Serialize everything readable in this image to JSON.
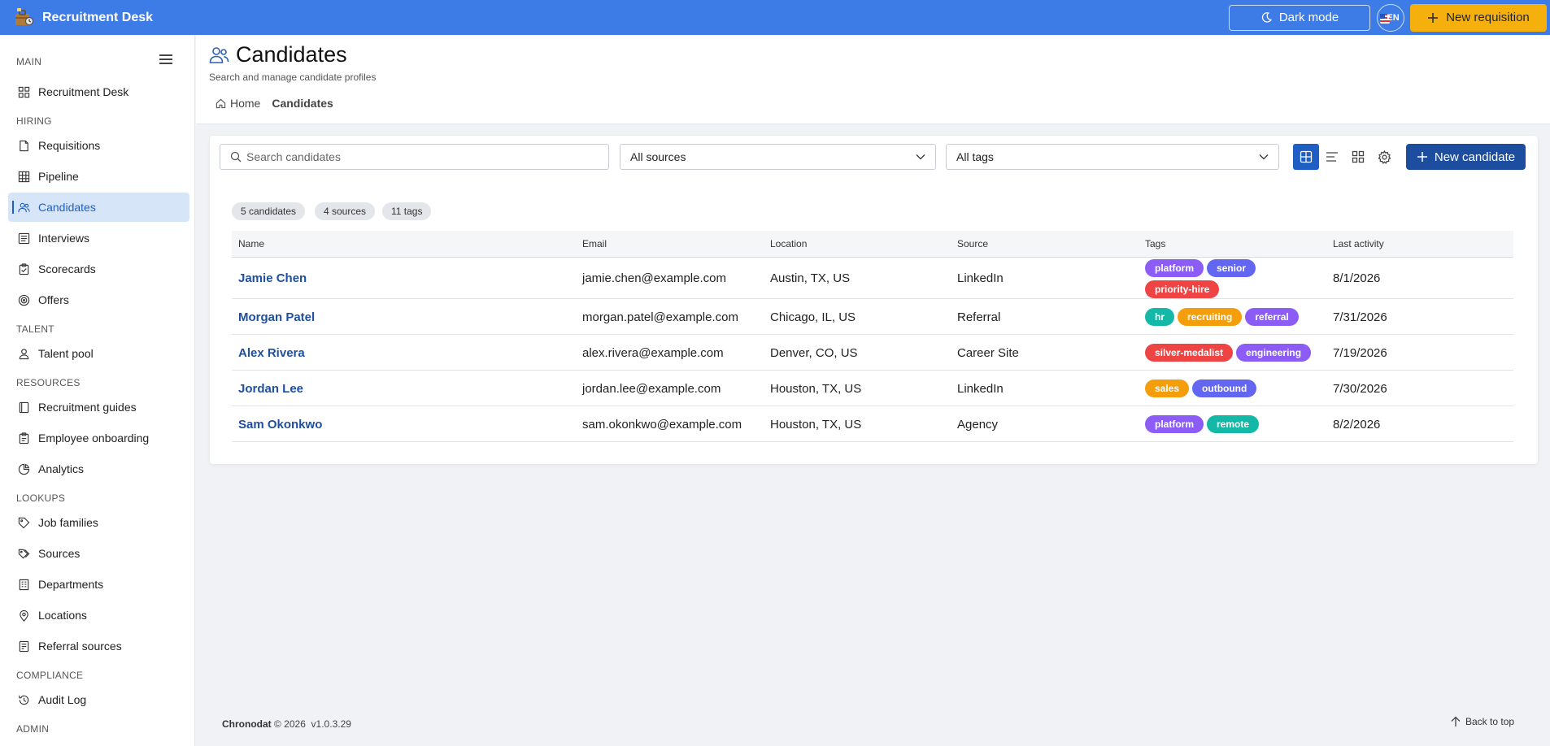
{
  "app": {
    "title": "Recruitment Desk",
    "dark_mode_label": "Dark mode",
    "language": "EN",
    "new_requisition_label": "New requisition"
  },
  "sidebar": {
    "groups": [
      {
        "heading": "MAIN",
        "items": [
          {
            "label": "Recruitment Desk",
            "icon": "dashboard-icon"
          }
        ]
      },
      {
        "heading": "HIRING",
        "items": [
          {
            "label": "Requisitions",
            "icon": "document-icon"
          },
          {
            "label": "Pipeline",
            "icon": "grid-table-icon"
          },
          {
            "label": "Candidates",
            "icon": "people-icon",
            "active": true
          },
          {
            "label": "Interviews",
            "icon": "list-icon"
          },
          {
            "label": "Scorecards",
            "icon": "clipboard-check-icon"
          },
          {
            "label": "Offers",
            "icon": "target-icon"
          }
        ]
      },
      {
        "heading": "TALENT",
        "items": [
          {
            "label": "Talent pool",
            "icon": "person-icon"
          }
        ]
      },
      {
        "heading": "RESOURCES",
        "items": [
          {
            "label": "Recruitment guides",
            "icon": "book-icon"
          },
          {
            "label": "Employee onboarding",
            "icon": "clipboard-icon"
          },
          {
            "label": "Analytics",
            "icon": "chart-icon"
          }
        ]
      },
      {
        "heading": "LOOKUPS",
        "items": [
          {
            "label": "Job families",
            "icon": "tag-icon"
          },
          {
            "label": "Sources",
            "icon": "tags-icon"
          },
          {
            "label": "Departments",
            "icon": "building-icon"
          },
          {
            "label": "Locations",
            "icon": "pin-icon"
          },
          {
            "label": "Referral sources",
            "icon": "form-icon"
          }
        ]
      },
      {
        "heading": "COMPLIANCE",
        "items": [
          {
            "label": "Audit Log",
            "icon": "history-icon"
          }
        ]
      },
      {
        "heading": "ADMIN",
        "items": []
      }
    ]
  },
  "header": {
    "title": "Candidates",
    "subtitle": "Search and manage candidate profiles",
    "breadcrumb_home": "Home",
    "breadcrumb_current": "Candidates"
  },
  "toolbar": {
    "search_placeholder": "Search candidates",
    "source_filter": "All sources",
    "tag_filter": "All tags",
    "new_candidate_label": "New candidate"
  },
  "summary": {
    "candidates": "5 candidates",
    "sources": "4 sources",
    "tags": "11 tags"
  },
  "table": {
    "columns": [
      "Name",
      "Email",
      "Location",
      "Source",
      "Tags",
      "Last activity"
    ],
    "rows": [
      {
        "name": "Jamie Chen",
        "email": "jamie.chen@example.com",
        "location": "Austin, TX, US",
        "source": "LinkedIn",
        "tags": [
          "platform",
          "senior",
          "priority-hire"
        ],
        "last_activity": "8/1/2026"
      },
      {
        "name": "Morgan Patel",
        "email": "morgan.patel@example.com",
        "location": "Chicago, IL, US",
        "source": "Referral",
        "tags": [
          "hr",
          "recruiting",
          "referral"
        ],
        "last_activity": "7/31/2026"
      },
      {
        "name": "Alex Rivera",
        "email": "alex.rivera@example.com",
        "location": "Denver, CO, US",
        "source": "Career Site",
        "tags": [
          "silver-medalist",
          "engineering"
        ],
        "last_activity": "7/19/2026"
      },
      {
        "name": "Jordan Lee",
        "email": "jordan.lee@example.com",
        "location": "Houston, TX, US",
        "source": "LinkedIn",
        "tags": [
          "sales",
          "outbound"
        ],
        "last_activity": "7/30/2026"
      },
      {
        "name": "Sam Okonkwo",
        "email": "sam.okonkwo@example.com",
        "location": "Houston, TX, US",
        "source": "Agency",
        "tags": [
          "platform",
          "remote"
        ],
        "last_activity": "8/2/2026"
      }
    ]
  },
  "tag_colors": {
    "platform": "#8b5cf6",
    "senior": "#6366f1",
    "priority-hire": "#ef4444",
    "hr": "#14b8a6",
    "recruiting": "#f59e0b",
    "referral": "#8b5cf6",
    "silver-medalist": "#ef4444",
    "engineering": "#8b5cf6",
    "sales": "#f59e0b",
    "outbound": "#6366f1",
    "remote": "#14b8a6"
  },
  "footer": {
    "brand": "Chronodat",
    "copyright": "© 2026",
    "version": "v1.0.3.29",
    "back_to_top": "Back to top"
  }
}
